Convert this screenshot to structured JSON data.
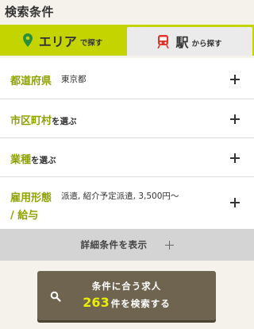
{
  "page": {
    "title": "検索条件"
  },
  "tabs": {
    "area": {
      "label": "エリア",
      "sub": "で探す",
      "icon": "map-pin-icon"
    },
    "station": {
      "label": "駅",
      "sub": "から探す",
      "icon": "train-icon"
    }
  },
  "criteria": {
    "prefecture": {
      "label": "都道府県",
      "value": "東京都"
    },
    "city": {
      "label": "市区町村",
      "suffix": "を選ぶ"
    },
    "industry": {
      "label": "業種",
      "suffix": "を選ぶ"
    },
    "employment": {
      "label_line1": "雇用形態",
      "label_line2": "/ 給与",
      "value": "派遣, 紹介予定派遣, 3,500円〜"
    }
  },
  "detail": {
    "label": "詳細条件を表示"
  },
  "search": {
    "line1": "条件に合う求人",
    "count": "263",
    "line2": "件を検索する",
    "icon": "search-icon"
  },
  "colors": {
    "accent": "#c4d400",
    "label_green": "#8fa300",
    "button_brown": "#6e6450",
    "count_yellow": "#e8f000",
    "train_red": "#e0352b"
  }
}
